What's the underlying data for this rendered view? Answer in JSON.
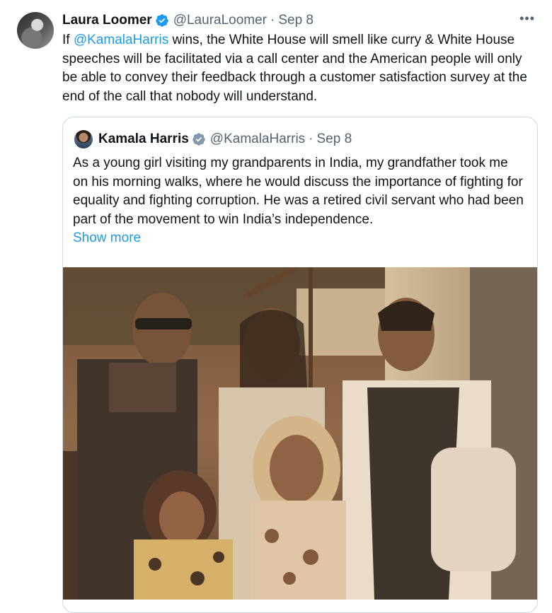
{
  "tweet": {
    "author_name": "Laura Loomer",
    "handle": "@LauraLoomer",
    "separator": "·",
    "date": "Sep 8",
    "more_icon": "more-icon",
    "text_before": "If ",
    "mention": "@KamalaHarris",
    "text_after": " wins, the White House will smell like curry & White House speeches will be facilitated via a call center and the American people will only be able to convey their feedback through a customer satisfaction survey at the end of the call that nobody will understand."
  },
  "quoted": {
    "author_name": "Kamala Harris",
    "handle": "@KamalaHarris",
    "separator": "·",
    "date": "Sep 8",
    "text": "As a young girl visiting my grandparents in India, my grandfather took me on his morning walks, where he would discuss the importance of fighting for equality and fighting corruption. He was a retired civil servant who had been part of the movement to win India’s independence.",
    "show_more": "Show more"
  },
  "colors": {
    "accent": "#1d9bf0",
    "text": "#0f1419",
    "muted": "#536471",
    "border": "#cfd9de",
    "verified": "#1d9bf0"
  }
}
